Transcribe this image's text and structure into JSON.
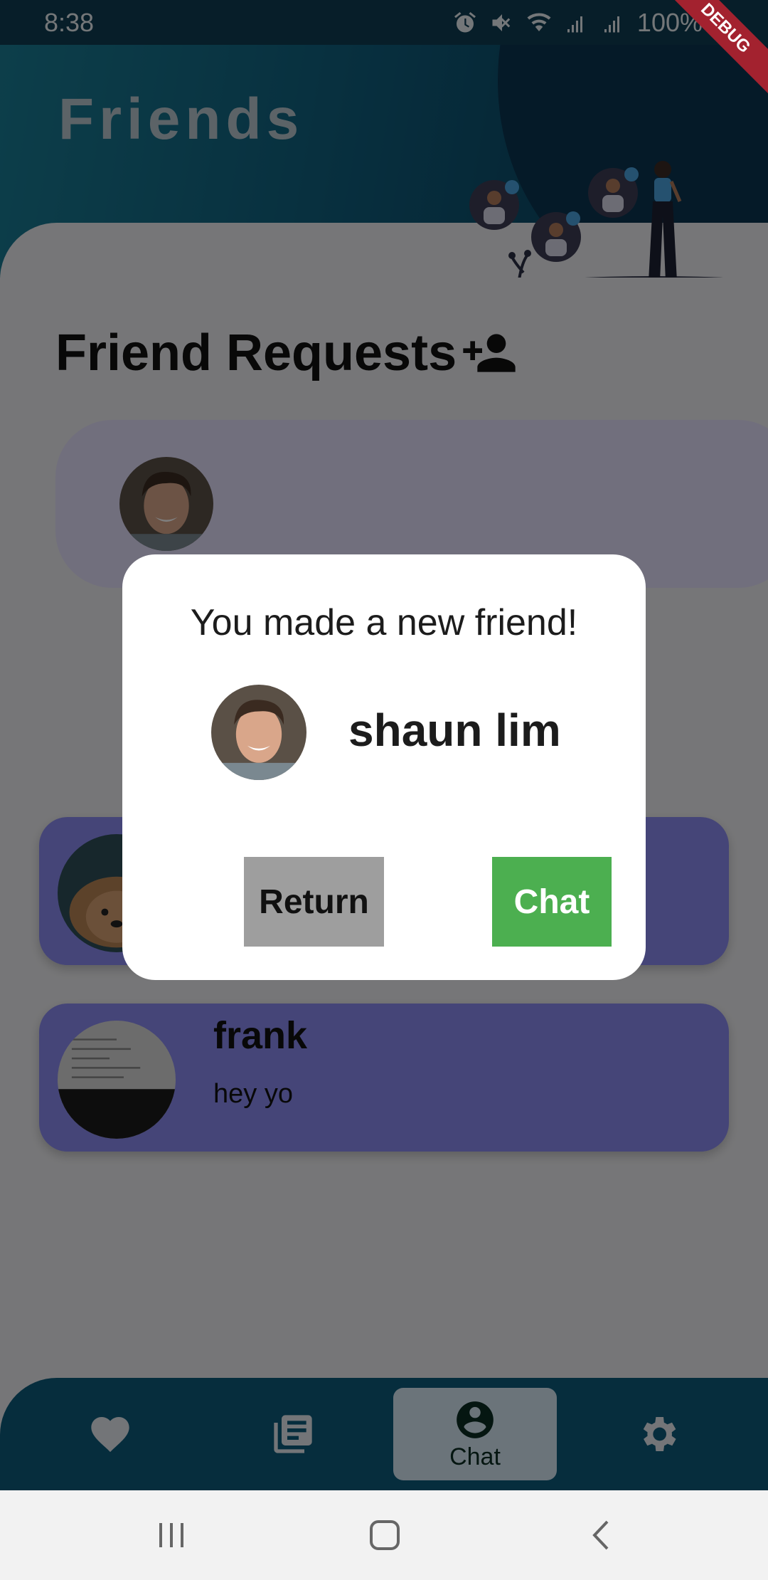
{
  "status_bar": {
    "time": "8:38",
    "battery": "100%"
  },
  "header": {
    "title": "Friends"
  },
  "friend_requests": {
    "title": "Friend Requests"
  },
  "chats": [
    {
      "name": "frank",
      "message": "hey yo"
    }
  ],
  "dialog": {
    "title": "You made a new friend!",
    "friend_name": "shaun lim",
    "return_label": "Return",
    "chat_label": "Chat"
  },
  "bottom_nav": {
    "items": [
      {
        "icon": "heart-icon",
        "label": ""
      },
      {
        "icon": "library-icon",
        "label": ""
      },
      {
        "icon": "account-circle-icon",
        "label": "Chat"
      },
      {
        "icon": "gear-icon",
        "label": ""
      }
    ],
    "active_index": 2
  },
  "debug_banner": "DEBUG",
  "colors": {
    "accent": "#0d5a7a",
    "chat_button": "#4caf50",
    "return_button": "#9e9e9e",
    "card": "#8a8af0"
  }
}
